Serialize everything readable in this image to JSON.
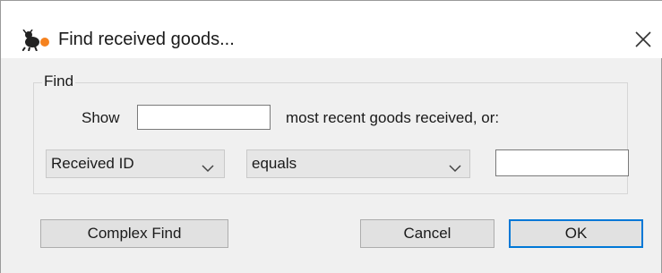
{
  "window": {
    "title": "Find received goods...",
    "icons": {
      "app": "mosquito-icon",
      "close": "close-icon"
    }
  },
  "find_group": {
    "label": "Find",
    "show_label": "Show",
    "recent_count_value": "",
    "recent_suffix": "most recent goods received, or:",
    "field_select": {
      "selected": "Received ID"
    },
    "operator_select": {
      "selected": "equals"
    },
    "criteria_value": ""
  },
  "buttons": {
    "complex_find": "Complex Find",
    "cancel": "Cancel",
    "ok": "OK"
  },
  "colors": {
    "accent": "#0078d7",
    "dialog_bg": "#f0f0f0"
  }
}
